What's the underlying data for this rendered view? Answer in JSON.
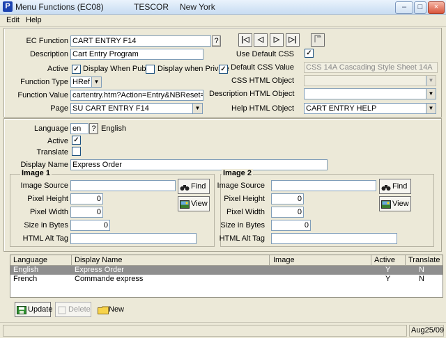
{
  "window": {
    "app_letter": "P",
    "title": "Menu Functions (EC08)",
    "company": "TESCOR",
    "city": "New York",
    "controls": [
      "–",
      "□",
      "×"
    ]
  },
  "menu": [
    "Edit",
    "Help"
  ],
  "function": {
    "ec_function_label": "EC Function",
    "ec_function_value": "CART ENTRY F14",
    "help_q": "?",
    "description_label": "Description",
    "description_value": "Cart Entry Program",
    "active_label": "Active",
    "active_checked": "✓",
    "display_when_public_label": "Display When Public",
    "display_when_public_checked": "",
    "display_when_private_label": "Display when Private",
    "display_when_private_checked": "✓",
    "function_type_label": "Function Type",
    "function_type_value": "HRef",
    "function_value_label": "Function Value",
    "function_value_value": "cartentry.htm?Action=Entry&NBReset=0",
    "page_label": "Page",
    "page_value": "SU CART ENTRY F14",
    "nav_buttons": [
      "|◁",
      "◁",
      "▷",
      "▷|"
    ],
    "use_default_css_label": "Use Default CSS",
    "use_default_css_checked": "✓",
    "default_css_label": "Default CSS Value",
    "default_css_value": "CSS 14A Cascading Style Sheet 14A",
    "css_html_label": "CSS HTML Object",
    "css_html_value": "",
    "desc_html_label": "Description HTML Object",
    "desc_html_value": "",
    "help_html_label": "Help HTML Object",
    "help_html_value": "CART ENTRY HELP"
  },
  "language": {
    "language_label": "Language",
    "language_code": "en",
    "language_name": "English",
    "active_label": "Active",
    "active_checked": "✓",
    "translate_label": "Translate",
    "translate_checked": "",
    "display_name_label": "Display Name",
    "display_name_value": "Express Order"
  },
  "image1": {
    "title": "Image 1",
    "source_label": "Image Source",
    "source_value": "",
    "height_label": "Pixel Height",
    "height_value": "0",
    "width_label": "Pixel Width",
    "width_value": "0",
    "size_label": "Size in Bytes",
    "size_value": "0",
    "alt_label": "HTML Alt Tag",
    "alt_value": "",
    "find_label": "Find",
    "view_label": "View"
  },
  "image2": {
    "title": "Image 2",
    "source_label": "Image Source",
    "source_value": "",
    "height_label": "Pixel Height",
    "height_value": "0",
    "width_label": "Pixel Width",
    "width_value": "0",
    "size_label": "Size in Bytes",
    "size_value": "0",
    "alt_label": "HTML Alt Tag",
    "alt_value": "",
    "find_label": "Find",
    "view_label": "View"
  },
  "grid": {
    "headers": [
      "Language",
      "Display Name",
      "Image",
      "Active",
      "Translate"
    ],
    "rows": [
      {
        "language": "English",
        "display_name": "Express Order",
        "image": "",
        "active": "Y",
        "translate": "N"
      },
      {
        "language": "French",
        "display_name": "Commande express",
        "image": "",
        "active": "Y",
        "translate": "N"
      }
    ]
  },
  "buttons": {
    "update": "Update",
    "delete": "Delete",
    "new": "New"
  },
  "status": {
    "date": "Aug25/09"
  },
  "colors": {
    "selected_row": "#8f8f8f",
    "title_accent": "#1c43b0"
  }
}
